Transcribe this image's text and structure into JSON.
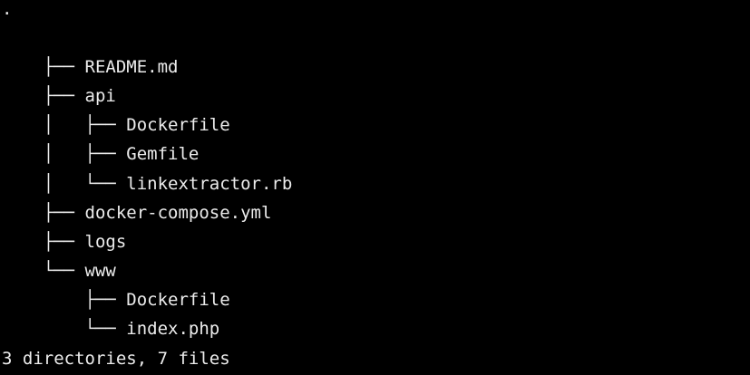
{
  "terminal": {
    "foreground": "#ececec",
    "background": "#000000",
    "root": ".",
    "entries": [
      {
        "prefix": "├── ",
        "name": "README.md"
      },
      {
        "prefix": "├── ",
        "name": "api"
      },
      {
        "prefix": "│   ├── ",
        "name": "Dockerfile"
      },
      {
        "prefix": "│   ├── ",
        "name": "Gemfile"
      },
      {
        "prefix": "│   └── ",
        "name": "linkextractor.rb"
      },
      {
        "prefix": "├── ",
        "name": "docker-compose.yml"
      },
      {
        "prefix": "├── ",
        "name": "logs"
      },
      {
        "prefix": "└── ",
        "name": "www"
      },
      {
        "prefix": "    ├── ",
        "name": "Dockerfile"
      },
      {
        "prefix": "    └── ",
        "name": "index.php"
      }
    ],
    "summary": "3 directories, 7 files"
  }
}
